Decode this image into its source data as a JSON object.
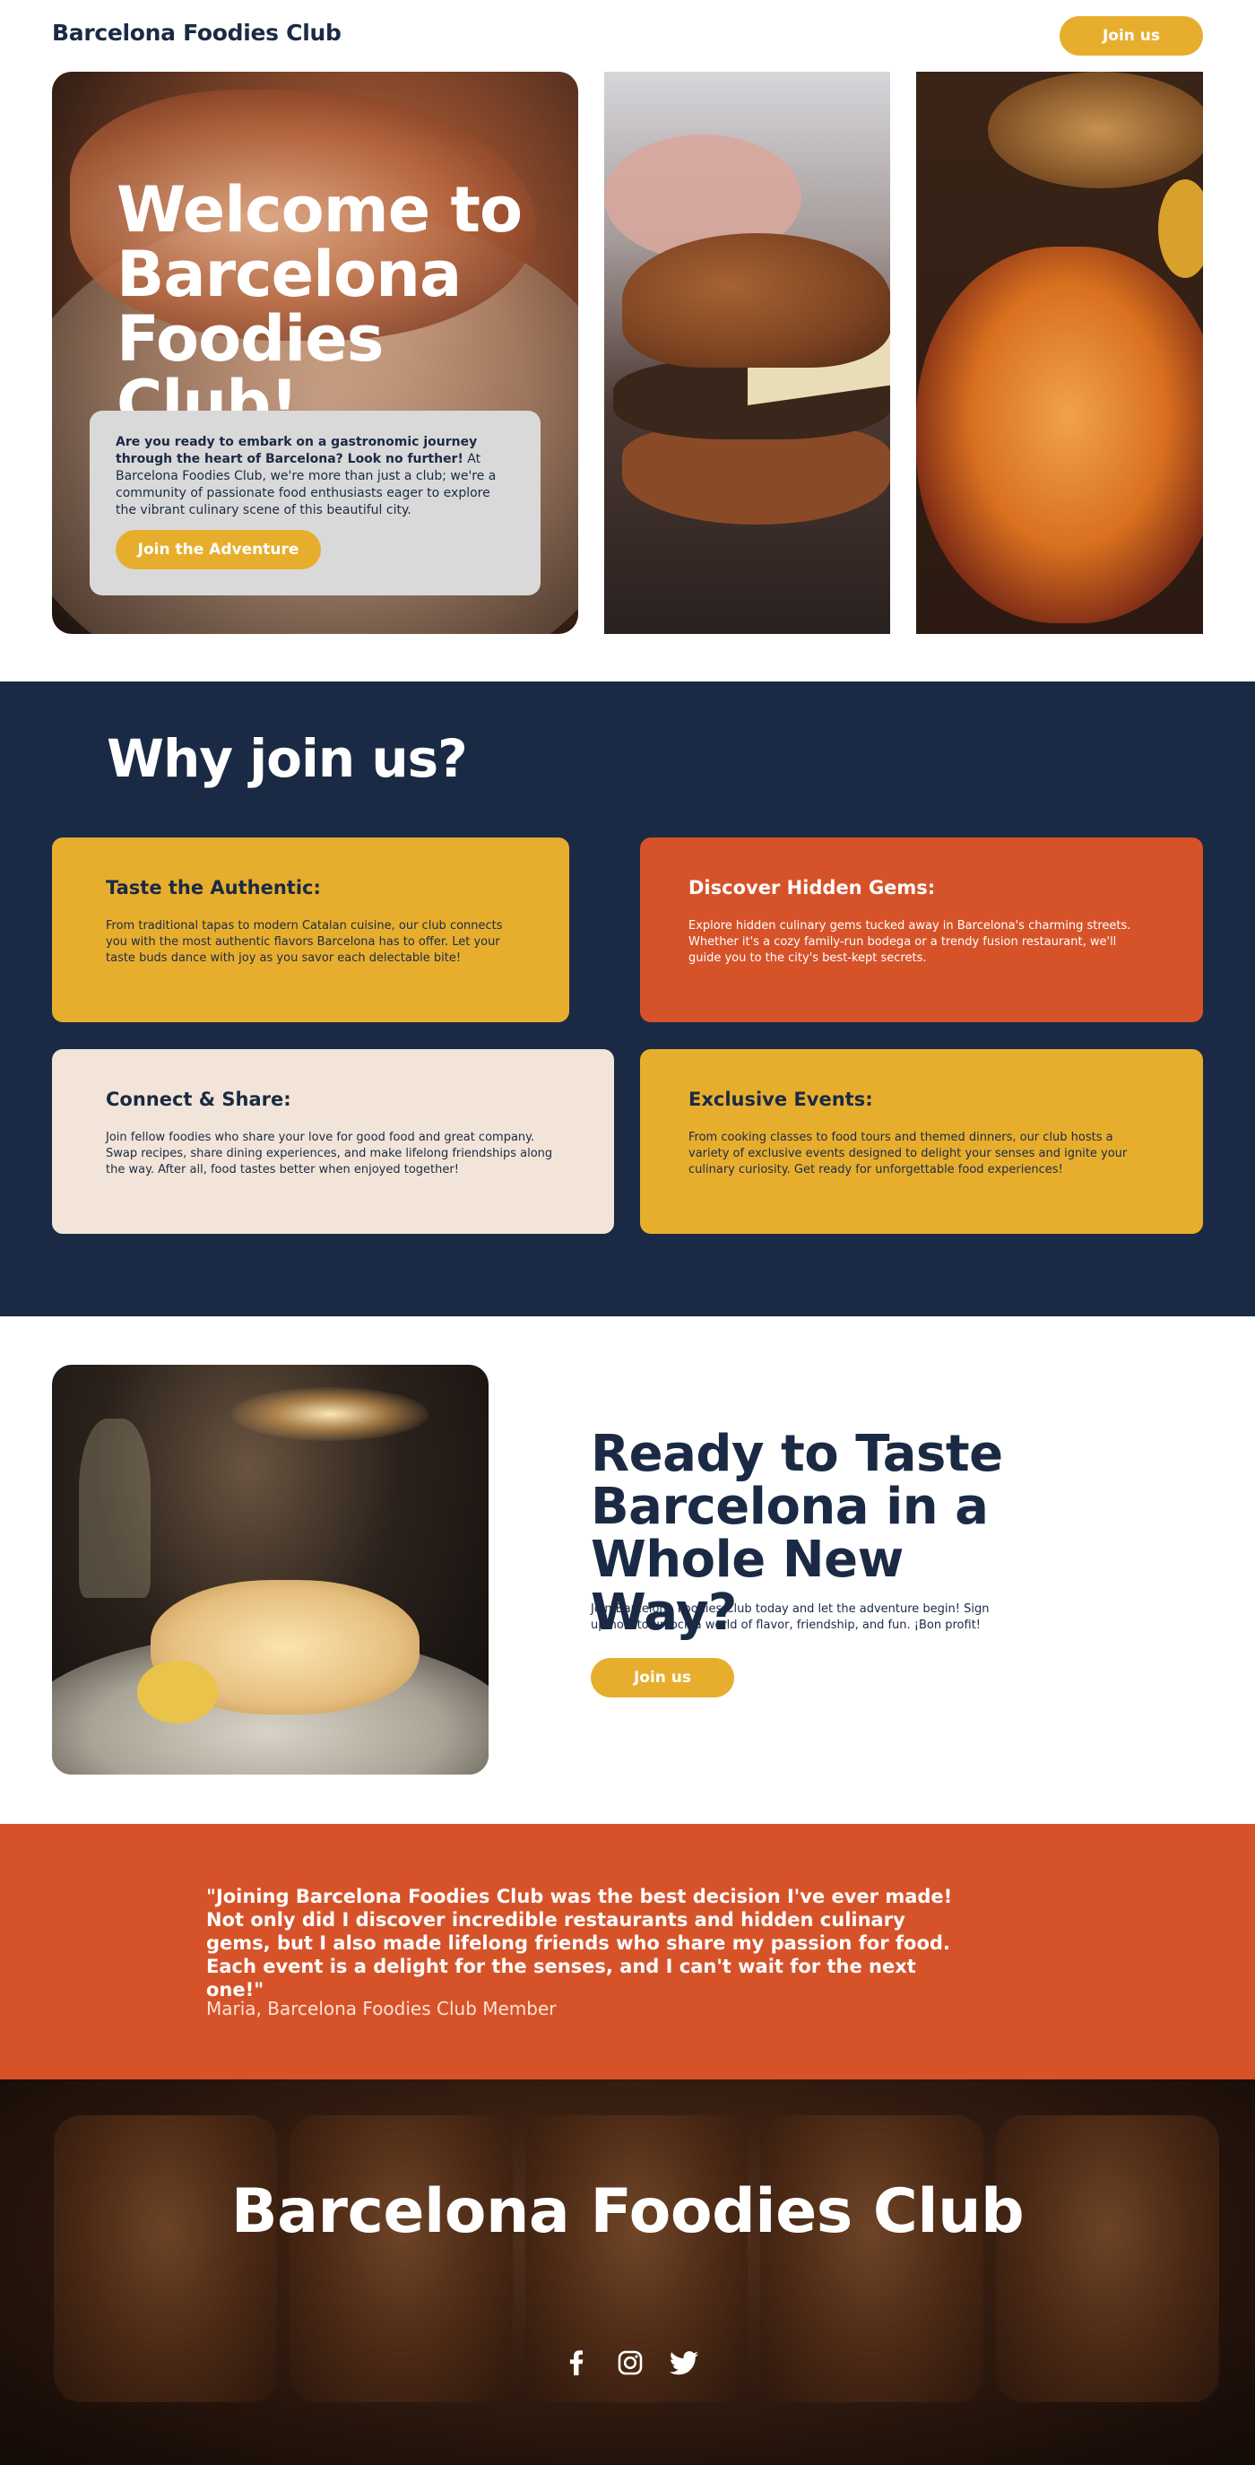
{
  "header": {
    "brand": "Barcelona Foodies Club",
    "join_label": "Join us"
  },
  "hero": {
    "title": "Welcome to Barcelona Foodies Club!",
    "intro_bold": "Are you ready to embark on a gastronomic journey through the heart of Barcelona? Look no further!",
    "intro_rest": " At Barcelona Foodies Club, we're more than just a club; we're a community of passionate food enthusiasts eager to explore the vibrant culinary scene of this beautiful city.",
    "cta_label": "Join the Adventure"
  },
  "why": {
    "title": "Why join us?",
    "cards": [
      {
        "title": "Taste the Authentic:",
        "text": "From traditional tapas to modern Catalan cuisine, our club connects you with the most authentic flavors Barcelona has to offer. Let your taste buds dance with joy as you savor each delectable bite!"
      },
      {
        "title": "Discover Hidden Gems:",
        "text": " Explore hidden culinary gems tucked away in Barcelona's charming streets. Whether it's a cozy family-run bodega or a trendy fusion restaurant, we'll guide you to the city's best-kept secrets."
      },
      {
        "title": "Connect & Share:",
        "text": "Join fellow foodies who share your love for good food and great company. Swap recipes, share dining experiences, and make lifelong friendships along the way. After all, food tastes better when enjoyed together!"
      },
      {
        "title": "Exclusive Events:",
        "text": "From cooking classes to food tours and themed dinners, our club hosts a variety of exclusive events designed to delight your senses and ignite your culinary curiosity. Get ready for unforgettable food experiences!"
      }
    ]
  },
  "cta": {
    "title": "Ready to Taste Barcelona in a Whole New Way?",
    "text": "Join Barcelona Foodies Club today and let the adventure begin! Sign up now to unlock a world of flavor, friendship, and fun. ¡Bon profit!",
    "join_label": "Join us"
  },
  "testimonial": {
    "quote": "\"Joining Barcelona Foodies Club was the best decision I've ever made! Not only did I discover incredible restaurants and hidden culinary gems, but I also made lifelong friends who share my passion for food. Each event is a delight for the senses, and I can't wait for the next one!\"",
    "author": "Maria, Barcelona Foodies Club Member"
  },
  "footer": {
    "title": "Barcelona Foodies Club",
    "socials": [
      "facebook-icon",
      "instagram-icon",
      "twitter-icon"
    ]
  },
  "colors": {
    "navy": "#1b2a44",
    "yellow": "#e7ae2e",
    "orange": "#d6532a",
    "cream": "#f2e4d8",
    "gray_card": "#d9d9d9"
  }
}
